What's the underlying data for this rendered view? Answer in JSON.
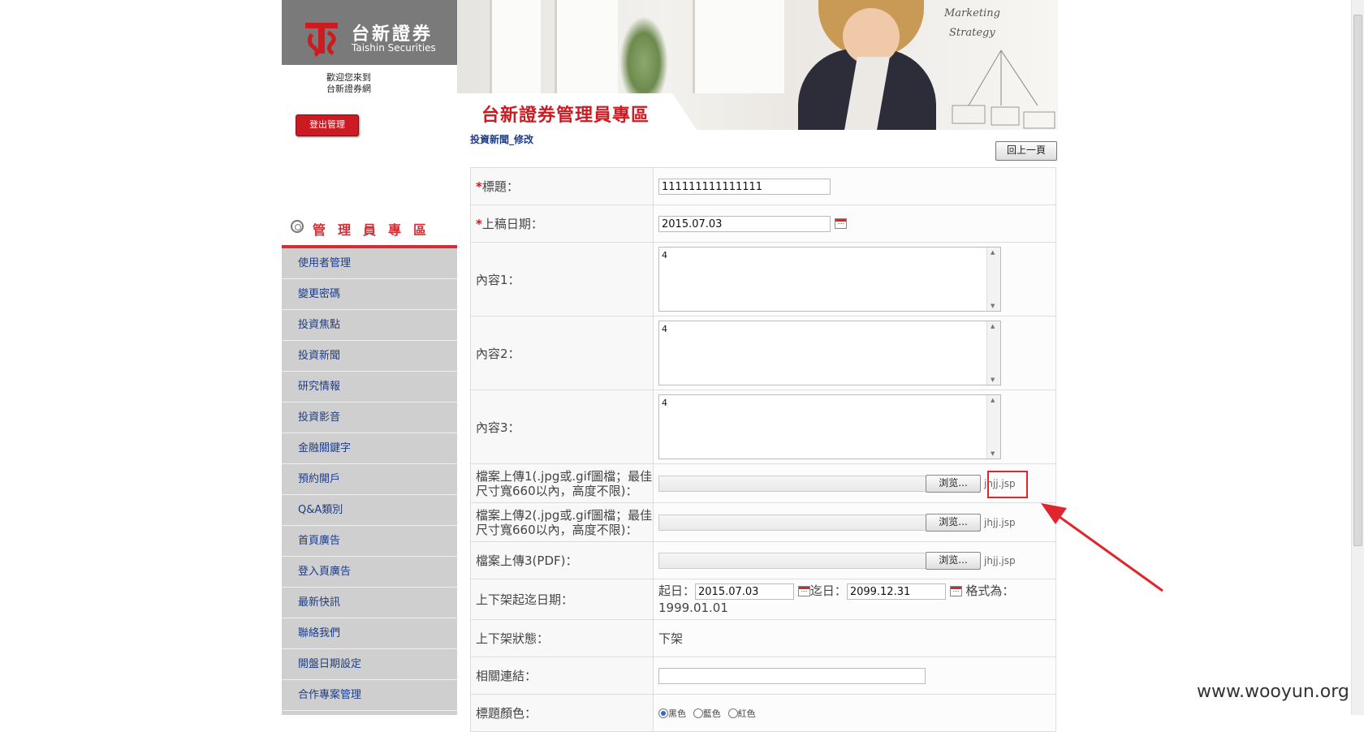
{
  "brand": {
    "name_cn": "台新證券",
    "name_en": "Taishin Securities",
    "color": "#cd1b22"
  },
  "sidebar": {
    "welcome_line1": "歡迎您來到",
    "welcome_line2": "台新證券網",
    "logout_label": "登出管理",
    "section_title": "管理員專區",
    "items": [
      {
        "label": "使用者管理"
      },
      {
        "label": "變更密碼"
      },
      {
        "label": "投資焦點"
      },
      {
        "label": "投資新聞"
      },
      {
        "label": "研究情報"
      },
      {
        "label": "投資影音"
      },
      {
        "label": "金融關鍵字"
      },
      {
        "label": "預約開戶"
      },
      {
        "label": "Q&A類別"
      },
      {
        "label": "首頁廣告"
      },
      {
        "label": "登入頁廣告"
      },
      {
        "label": "最新快訊"
      },
      {
        "label": "聯絡我們"
      },
      {
        "label": "開盤日期設定"
      },
      {
        "label": "合作專案管理"
      }
    ]
  },
  "banner": {
    "title": "台新證券管理員專區",
    "board_line1": "Marketing",
    "board_line2": "Strategy"
  },
  "page": {
    "breadcrumb": "投資新聞_修改",
    "back_label": "回上一頁"
  },
  "form": {
    "title_label": "標題：",
    "title_value": "111111111111111",
    "date_label": "上稿日期：",
    "date_value": "2015.07.03",
    "content1_label": "內容1：",
    "content1_value": "4",
    "content2_label": "內容2：",
    "content2_value": "4",
    "content3_label": "內容3：",
    "content3_value": "4",
    "upload1_label": "檔案上傳1(.jpg或.gif圖檔；最佳尺寸寬660以內，高度不限)：",
    "upload2_label": "檔案上傳2(.jpg或.gif圖檔；最佳尺寸寬660以內，高度不限)：",
    "upload3_label": "檔案上傳3(PDF)：",
    "browse_label": "浏览...",
    "file1_name": "jhjj.jsp",
    "file2_name": "jhjj.jsp",
    "file3_name": "jhjj.jsp",
    "period_label": "上下架起迄日期：",
    "start_prefix": "起日：",
    "start_value": "2015.07.03",
    "end_prefix": "迄日：",
    "end_value": "2099.12.31",
    "format_text": "格式為：1999.01.01",
    "status_label": "上下架狀態：",
    "status_value": "下架",
    "link_label": "相關連結：",
    "link_value": "",
    "color_label": "標題顏色：",
    "color_options": [
      "黑色",
      "藍色",
      "紅色"
    ],
    "color_selected": "黑色"
  },
  "annotation": {
    "highlight_color": "#e0262c"
  },
  "watermark": "www.wooyun.org"
}
